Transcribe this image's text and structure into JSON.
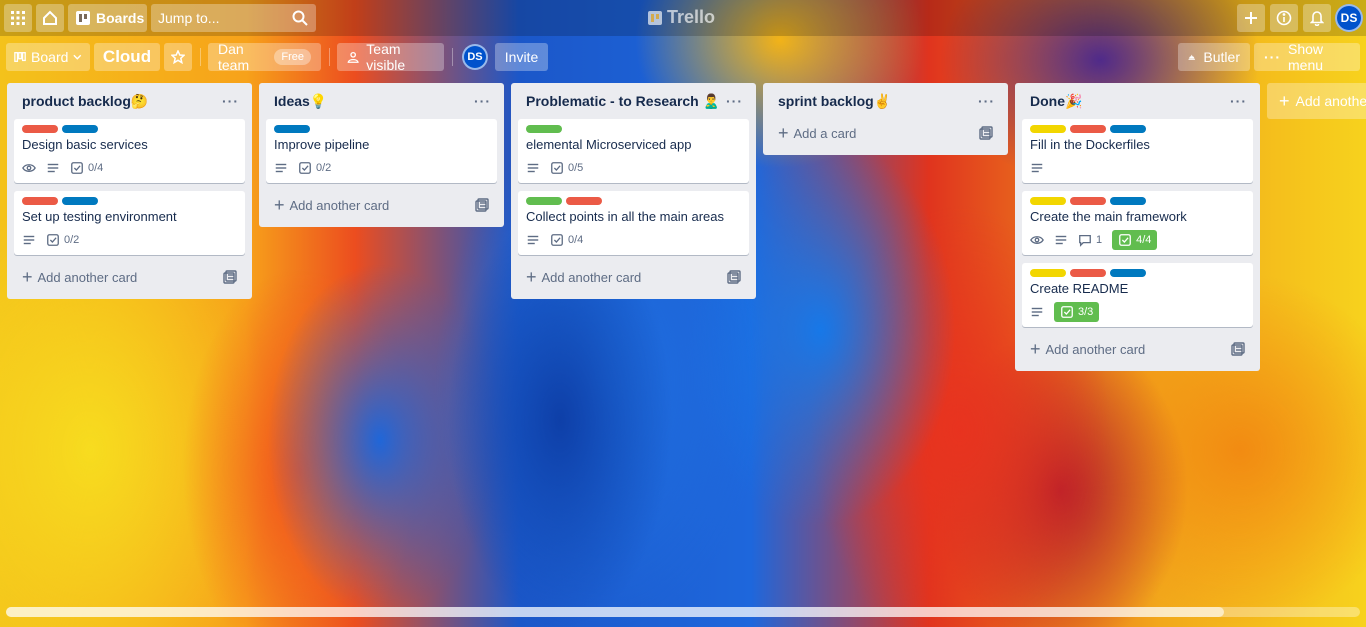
{
  "header": {
    "boards_label": "Boards",
    "search_placeholder": "Jump to...",
    "logo_text": "Trello",
    "avatar_initials": "DS"
  },
  "boardbar": {
    "view_label": "Board",
    "board_name": "Cloud",
    "team_name": "Dan team",
    "team_plan": "Free",
    "visibility": "Team visible",
    "member_initials": "DS",
    "invite_label": "Invite",
    "butler_label": "Butler",
    "menu_label": "Show menu"
  },
  "lists": [
    {
      "title": "product backlog🤔",
      "cards": [
        {
          "labels": [
            "#eb5a46",
            "#0079bf"
          ],
          "title": "Design basic services",
          "watch": true,
          "desc": true,
          "checklist": "0/4",
          "checklist_done": false
        },
        {
          "labels": [
            "#eb5a46",
            "#0079bf"
          ],
          "title": "Set up testing environment",
          "desc": true,
          "checklist": "0/2",
          "checklist_done": false
        }
      ],
      "add": "Add another card"
    },
    {
      "title": "Ideas💡",
      "cards": [
        {
          "labels": [
            "#0079bf"
          ],
          "title": "Improve pipeline",
          "desc": true,
          "checklist": "0/2",
          "checklist_done": false
        }
      ],
      "add": "Add another card"
    },
    {
      "title": "Problematic - to Research 🙎‍♂️",
      "cards": [
        {
          "labels": [
            "#61bd4f"
          ],
          "title": "elemental Microserviced app",
          "desc": true,
          "checklist": "0/5",
          "checklist_done": false
        },
        {
          "labels": [
            "#61bd4f",
            "#eb5a46"
          ],
          "title": "Collect points in all the main areas",
          "desc": true,
          "checklist": "0/4",
          "checklist_done": false
        }
      ],
      "add": "Add another card"
    },
    {
      "title": "sprint backlog✌️",
      "cards": [],
      "add": "Add a card"
    },
    {
      "title": "Done🎉",
      "cards": [
        {
          "labels": [
            "#f2d600",
            "#eb5a46",
            "#0079bf"
          ],
          "title": "Fill in the Dockerfiles",
          "desc": true
        },
        {
          "labels": [
            "#f2d600",
            "#eb5a46",
            "#0079bf"
          ],
          "title": "Create the main framework",
          "watch": true,
          "desc": true,
          "comments": "1",
          "checklist": "4/4",
          "checklist_done": true
        },
        {
          "labels": [
            "#f2d600",
            "#eb5a46",
            "#0079bf"
          ],
          "title": "Create README",
          "desc": true,
          "checklist": "3/3",
          "checklist_done": true
        }
      ],
      "add": "Add another card"
    }
  ],
  "add_list_label": "Add another list"
}
